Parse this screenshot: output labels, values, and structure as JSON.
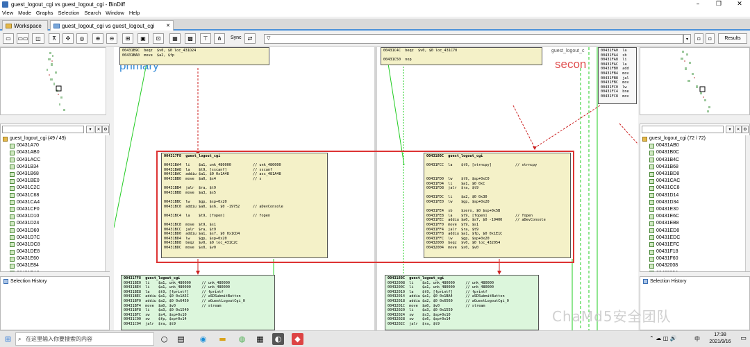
{
  "window": {
    "title": "guest_logout_cgi vs guest_logout_cgi - BinDiff",
    "min": "–",
    "max": "❐",
    "close": "✕"
  },
  "menu": [
    "View",
    "Mode",
    "Graphs",
    "Selection",
    "Search",
    "Window",
    "Help"
  ],
  "tabs": [
    {
      "label": "Workspace"
    },
    {
      "label": "guest_logout_cgi vs guest_logout_cgi",
      "close": "✕"
    }
  ],
  "toolbar": {
    "sync_label": "Sync",
    "search_value": "▽",
    "results_label": "Results"
  },
  "left_panel": {
    "header": "guest_logout_cgi (49 / 49)",
    "items": [
      "00431A70",
      "00431AB0",
      "00431ACC",
      "00431B34",
      "00431B68",
      "00431BE0",
      "00431C2C",
      "00431C68",
      "00431CA4",
      "00431CF0",
      "00431D10",
      "00431D24",
      "00431D60",
      "00431D7C",
      "00431DC8",
      "00431DE8",
      "00431E60",
      "00431E84",
      "00431EA0",
      "00431EE8"
    ],
    "history": "Selection History"
  },
  "right_panel": {
    "header": "guest_logout_cgi (72 / 72)",
    "items": [
      "00431AB0",
      "00431B0C",
      "00431B4C",
      "00431B68",
      "00431BD8",
      "00431CAC",
      "00431CC8",
      "00431D14",
      "00431D34",
      "00431E30",
      "00431E6C",
      "00431EB8",
      "00431ED8",
      "00431EDC",
      "00431EFC",
      "00431F18",
      "00431F60",
      "00432008",
      "00432054",
      "00432090"
    ],
    "history": "Selection History"
  },
  "graph": {
    "primary_label": "primary",
    "secondary_label": "secon",
    "secondary_title": "guest_logout_c"
  },
  "nodes": {
    "p_top": [
      "00431B9C  beqz  $v0, $0 loc_431D24",
      "00431BA0  move  $a2, $fp"
    ],
    "s_top": [
      "00431C4C  beqz  $v0, $0 loc_431C70",
      "",
      "00431C50  nop"
    ],
    "s_mini": [
      "00431FA0  la",
      "00431FA4  sb",
      "00431FA8  li",
      "00431FAC  la",
      "00431FB0  add",
      "00431FB4  mov",
      "00431FB8  jal",
      "00431FBC  mov",
      "00431FC0  lw",
      "00431FC4  bne",
      "00431FC8  mov"
    ],
    "p_main": [
      "004317F8  guest_logout_cgi",
      "",
      "00431BA4  li    $a1, unk_480000          // unk_480000",
      "00431BA8  la    $t9, [sscanf]            // sscanf",
      "00431BAC  addiu $a1, $0 0x1A48           // asc_481A48",
      "00431BB0  move  $a0, $s4                 // s",
      "",
      "00431BB4  jalr  $ra, $t9",
      "00431BB8  move  $a3, $s5",
      "",
      "00431BBC  lw    $gp, $sp+0x20",
      "00431BC0  addiu $a0, $s6, $0 -19752      // aDevConsole",
      "",
      "00431BC4  la    $t9, [fopen]             // fopen",
      "",
      "00431BC8  move  $t9, $s1",
      "00431BCC  jalr  $ra, $t9",
      "00431BD0  addiu $a1, $s7, $0 0x1CD4",
      "00431BD4  lw    $gp, $sp+0x20",
      "00431BD8  beqz  $v0, $0 loc_431C2C",
      "00431BDC  move  $s0, $v0"
    ],
    "s_main": [
      "0043180C  guest_logout_cgi",
      "",
      "00431FCC  la    $t9, [strncpy]           // strncpy",
      "",
      "",
      "00431FD0  lw    $t9, $sp+0xC0",
      "00431FD4  li    $a1, $0 0xC",
      "00431FD8  jalr  $ra, $t9",
      "",
      "00431FDC  li    $a2, $0 0x30",
      "00431FE0  lw    $gp, $sp+0x20",
      "",
      "00431FE4  sb    $zero, $0 $sp+0x5B",
      "00431FE8  la    $t9, [fopen]             // fopen",
      "00431FEC  addiu $a0, $s7, $0 -19400      // aDevConsole",
      "00431FF0  move  $t9, $s1",
      "00431FF4  jalr  $ra, $t9",
      "00431FF8  addiu $a1, $fp, $0 0x1E1C",
      "00431FFC  lw    $gp, $sp+0x20",
      "00432000  beqz  $v0, $0 loc_432054",
      "00432004  move  $s0, $v0"
    ],
    "p_bottom": [
      "004317F8  guest_logout_cgi",
      "00431BE0  li    $a1, unk_480000     // unk_480000",
      "00431BE4  li    $a1, unk_480000     // unk_480000",
      "00431BE8  la    $t9, [fprintf]      // fprintf",
      "00431BEC  addiu $a1, $0 0x1A5C      // aSDSubmitButton",
      "00431BF0  addiu $a2, $0 0x6450      // aGuestLogoutCgi_0",
      "00431BF4  move  $a0, $v0            // stream",
      "00431BF8  li    $a3, $0 0x1549",
      "00431BFC  sw    $s4, $sp+0x10",
      "00431C00  sw    $fp, $sp+0x14",
      "00431C04  jalr  $ra, $t9"
    ],
    "s_bottom": [
      "0043180C  guest_logout_cgi",
      "00432008  li    $a1, unk_480000     // unk_480000",
      "0043200C  li    $a1, unk_480000     // unk_480000",
      "00432010  la    $t9, [fprintf]      // fprintf",
      "00432014  addiu $a1, $0 0x1BA4      // aSDSubmitButton",
      "00432018  addiu $a2, $0 0x6560      // aGuestLogoutCgi_0",
      "0043201C  move  $a0, $v0            // stream",
      "00432020  li    $a3, $0 0x1559",
      "00432024  sw    $s3, $sp+0x10",
      "00432028  sw    $s6, $sp+0x14",
      "0043202C  jalr  $ra, $t9"
    ]
  },
  "taskbar": {
    "search_placeholder": "在这里输入你要搜索的内容",
    "clock_time": "17:38",
    "clock_date": "2021/9/16",
    "ime": "中",
    "tray": "⌃ ☁ ◫ 🔊"
  },
  "watermark": "ChaMd5安全团队"
}
